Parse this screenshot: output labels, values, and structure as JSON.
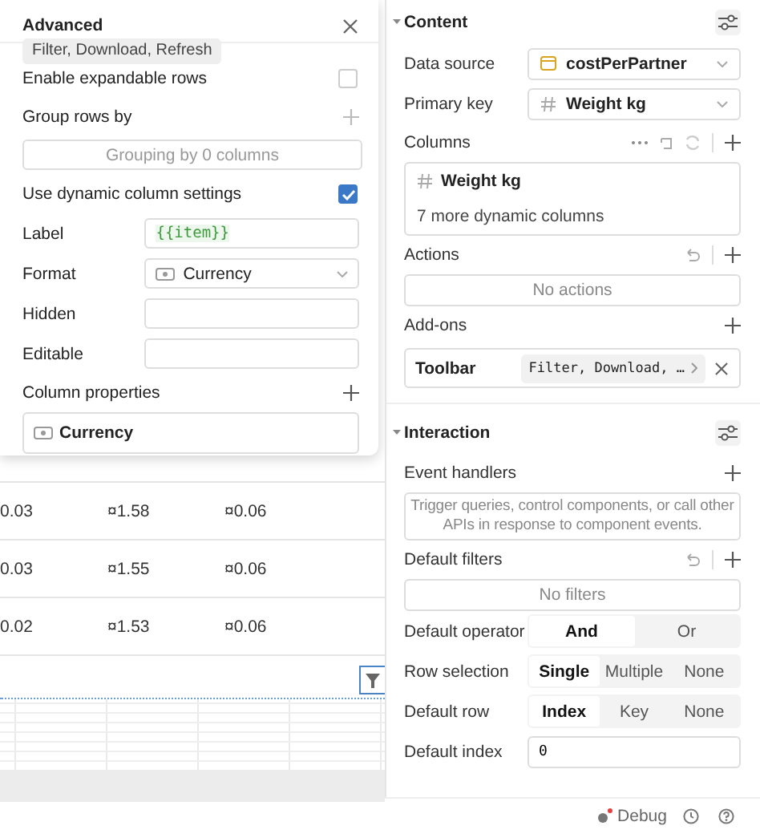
{
  "advanced_popover": {
    "title": "Advanced",
    "tooltip": "Filter, Download, Refresh",
    "expandable_rows": {
      "label": "Enable expandable rows",
      "checked": false
    },
    "group_rows_by": {
      "label": "Group rows by",
      "placeholder": "Grouping by 0 columns"
    },
    "dynamic_columns": {
      "label": "Use dynamic column settings",
      "checked": true
    },
    "fields": [
      {
        "label": "Label",
        "kind": "code",
        "value": "{{item}}"
      },
      {
        "label": "Format",
        "kind": "select",
        "value": "Currency"
      },
      {
        "label": "Hidden",
        "kind": "text"
      },
      {
        "label": "Editable",
        "kind": "text"
      }
    ],
    "column_properties": {
      "label": "Column properties",
      "items": [
        "Currency"
      ]
    }
  },
  "table": {
    "rows": [
      [
        "0.03",
        "¤1.58",
        "¤0.06"
      ],
      [
        "0.03",
        "¤1.55",
        "¤0.06"
      ],
      [
        "0.02",
        "¤1.53",
        "¤0.06"
      ]
    ]
  },
  "content": {
    "title": "Content",
    "expanded": true,
    "data_source": {
      "label": "Data source",
      "value": "costPerPartner"
    },
    "primary_key": {
      "label": "Primary key",
      "value": "Weight kg"
    },
    "columns": {
      "label": "Columns",
      "items": [
        "Weight kg"
      ],
      "more": "7 more dynamic columns"
    },
    "actions": {
      "label": "Actions",
      "empty": "No actions"
    },
    "addons": {
      "label": "Add-ons",
      "items": [
        {
          "name": "Toolbar",
          "value": "Filter, Download, …"
        }
      ]
    }
  },
  "interaction": {
    "title": "Interaction",
    "expanded": true,
    "event_handlers": {
      "label": "Event handlers",
      "empty": "Trigger queries, control components, or call other APIs in response to component events."
    },
    "default_filters": {
      "label": "Default filters",
      "empty": "No filters"
    },
    "segments": [
      {
        "label": "Default operator",
        "options": [
          {
            "label": "And",
            "selected": true
          },
          {
            "label": "Or",
            "selected": false
          }
        ]
      },
      {
        "label": "Row selection",
        "options": [
          {
            "label": "Single",
            "selected": true
          },
          {
            "label": "Multiple",
            "selected": false
          },
          {
            "label": "None",
            "selected": false
          }
        ]
      },
      {
        "label": "Default row",
        "options": [
          {
            "label": "Index",
            "selected": true
          },
          {
            "label": "Key",
            "selected": false
          },
          {
            "label": "None",
            "selected": false
          }
        ]
      }
    ],
    "default_index": {
      "label": "Default index",
      "value": "0"
    }
  },
  "status_bar": {
    "debug": "Debug"
  }
}
